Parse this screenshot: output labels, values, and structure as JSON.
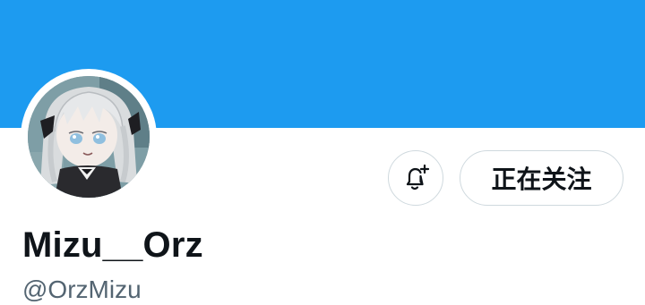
{
  "profile": {
    "display_name": "Mizu__Orz",
    "handle": "@OrzMizu",
    "banner_color": "#1d9bf0",
    "avatar": "avatar-image"
  },
  "actions": {
    "notify_icon": "bell-plus-icon",
    "follow_label": "正在关注"
  },
  "colors": {
    "text_primary": "#0f1419",
    "text_secondary": "#536471",
    "button_border": "#cfd9de"
  }
}
